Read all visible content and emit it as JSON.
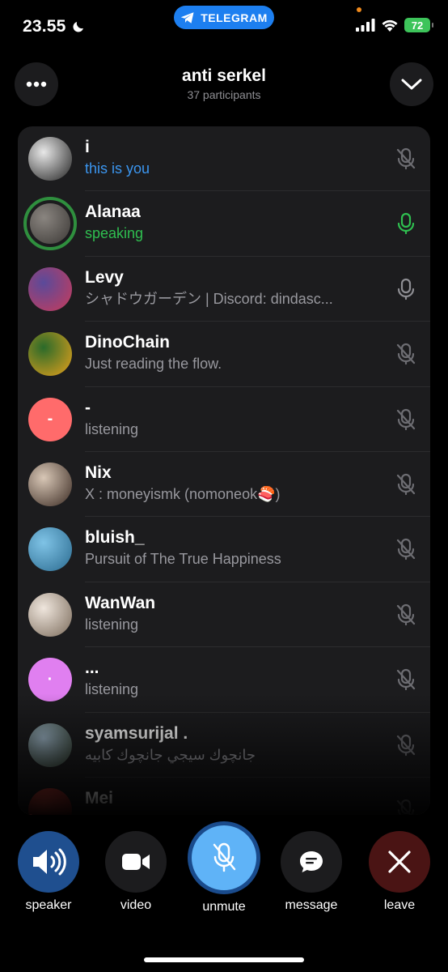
{
  "status_bar": {
    "time": "23.55",
    "app_pill_label": "TELEGRAM",
    "battery": "72"
  },
  "header": {
    "title": "anti serkel",
    "subtitle": "37 participants"
  },
  "participants": [
    {
      "name": "i",
      "status": "this is you",
      "status_type": "you",
      "mic": "muted",
      "avatar_colors": [
        "#e8e8e8",
        "#222"
      ]
    },
    {
      "name": "Alanaa",
      "status": "speaking",
      "status_type": "speaking",
      "mic": "active",
      "avatar_colors": [
        "#8a8580",
        "#3b3835"
      ]
    },
    {
      "name": "Levy",
      "status": "シャドウガーデン | Discord: dindasc...",
      "status_type": "normal",
      "mic": "unmuted",
      "avatar_colors": [
        "#5a4a9a",
        "#c93b5a"
      ]
    },
    {
      "name": "DinoChain",
      "status": "Just reading the flow.",
      "status_type": "normal",
      "mic": "muted",
      "avatar_colors": [
        "#2a6a2a",
        "#e7a11c"
      ]
    },
    {
      "name": "-",
      "status": "listening",
      "status_type": "normal",
      "mic": "muted",
      "avatar_colors": [
        "#ff6b6b",
        "#ff4f5e"
      ],
      "avatar_letter": "-"
    },
    {
      "name": "Nix",
      "status": "X : moneyismk (nomoneok🍣)",
      "status_type": "normal",
      "mic": "muted",
      "avatar_colors": [
        "#d8c7b6",
        "#3a2a22"
      ]
    },
    {
      "name": "bluish_",
      "status": "Pursuit of The True Happiness",
      "status_type": "normal",
      "mic": "muted",
      "avatar_colors": [
        "#7fc3e6",
        "#2a6a8f"
      ]
    },
    {
      "name": "WanWan",
      "status": "listening",
      "status_type": "normal",
      "mic": "muted",
      "avatar_colors": [
        "#efe6dd",
        "#7a6a5a"
      ]
    },
    {
      "name": "...",
      "status": "listening",
      "status_type": "normal",
      "mic": "muted",
      "avatar_colors": [
        "#e07ff0",
        "#c55fe0"
      ],
      "avatar_letter": "·"
    },
    {
      "name": "syamsurijal .",
      "status": "جانچوك سيجي جانچوك كابيه",
      "status_type": "normal",
      "mic": "muted",
      "avatar_colors": [
        "#9fb7c8",
        "#2e3a2a"
      ]
    },
    {
      "name": "Mei",
      "status": "",
      "status_type": "normal",
      "mic": "muted",
      "avatar_colors": [
        "#c2433a",
        "#6a1a1a"
      ]
    }
  ],
  "controls": {
    "speaker": "speaker",
    "video": "video",
    "unmute": "unmute",
    "message": "message",
    "leave": "leave"
  },
  "colors": {
    "accent_blue": "#1d7ff0",
    "speaking_green": "#2fbf50",
    "you_blue": "#3b96f0",
    "leave_red": "#4a1414",
    "speaker_blue": "#1f4f8f"
  }
}
